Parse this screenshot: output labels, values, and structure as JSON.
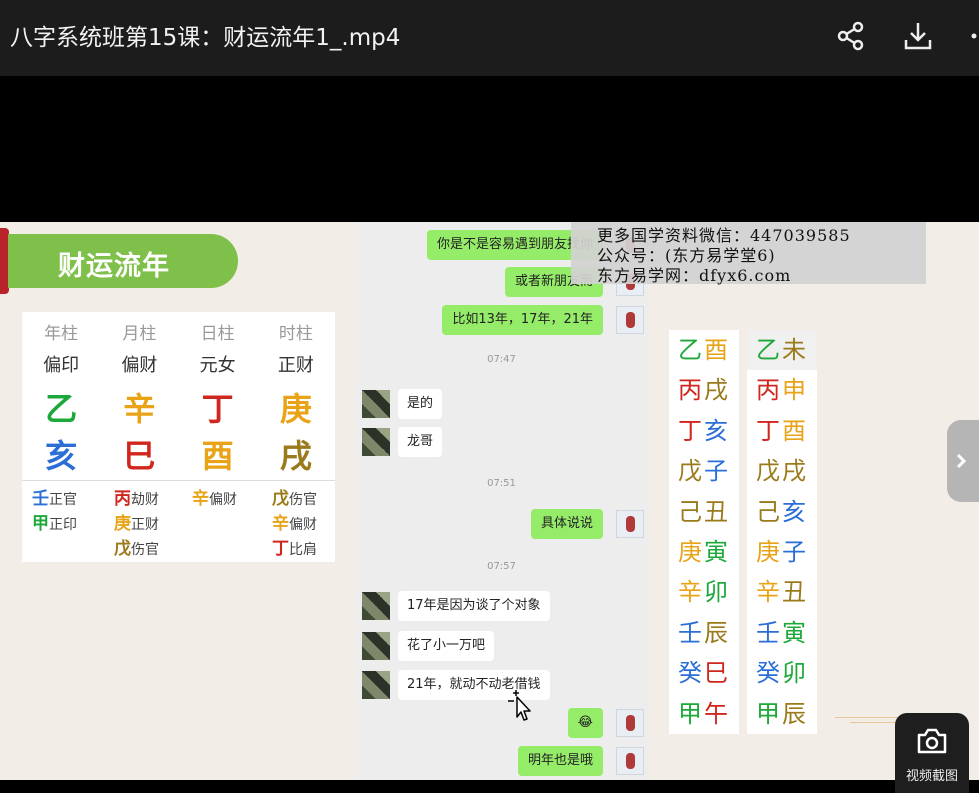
{
  "window": {
    "title": "八字系统班第15课：财运流年1_.mp4"
  },
  "toolbar": {
    "share_icon": "share-icon",
    "download_icon": "download-icon",
    "more_icon": "more-icon"
  },
  "slide": {
    "banner": "财运流年",
    "chart": {
      "headers": [
        "年柱",
        "月柱",
        "日柱",
        "时柱"
      ],
      "gods": [
        "偏印",
        "偏财",
        "元女",
        "正财"
      ],
      "stems": [
        {
          "char": "乙",
          "color": "#1fa83a"
        },
        {
          "char": "辛",
          "color": "#e8a317"
        },
        {
          "char": "丁",
          "color": "#d0261d"
        },
        {
          "char": "庚",
          "color": "#e8a317"
        }
      ],
      "branches": [
        {
          "char": "亥",
          "color": "#2b6fd6"
        },
        {
          "char": "巳",
          "color": "#d0261d"
        },
        {
          "char": "酉",
          "color": "#e8a317"
        },
        {
          "char": "戌",
          "color": "#9a7a1a"
        }
      ],
      "hidden": [
        [
          {
            "stem": "壬",
            "god": "正官",
            "color": "#2b6fd6"
          },
          {
            "stem": "甲",
            "god": "正印",
            "color": "#1fa83a"
          }
        ],
        [
          {
            "stem": "丙",
            "god": "劫财",
            "color": "#d0261d"
          },
          {
            "stem": "庚",
            "god": "正财",
            "color": "#e8a317"
          },
          {
            "stem": "戊",
            "god": "伤官",
            "color": "#9a7a1a"
          }
        ],
        [
          {
            "stem": "辛",
            "god": "偏财",
            "color": "#e8a317"
          }
        ],
        [
          {
            "stem": "戊",
            "god": "伤官",
            "color": "#9a7a1a"
          },
          {
            "stem": "辛",
            "god": "偏财",
            "color": "#e8a317"
          },
          {
            "stem": "丁",
            "god": "比肩",
            "color": "#d0261d"
          }
        ]
      ]
    }
  },
  "chat": {
    "messages": [
      {
        "side": "right",
        "text": "你是不是容易遇到朋友找你"
      },
      {
        "side": "right",
        "text": "或者新朋友而"
      },
      {
        "side": "right",
        "text": "比如13年，17年，21年"
      },
      {
        "time": "07:47"
      },
      {
        "side": "left",
        "text": "是的"
      },
      {
        "side": "left",
        "text": "龙哥"
      },
      {
        "time": "07:51"
      },
      {
        "side": "right",
        "text": "具体说说"
      },
      {
        "time": "07:57"
      },
      {
        "side": "left",
        "text": "17年是因为谈了个对象"
      },
      {
        "side": "left",
        "text": "花了小一万吧"
      },
      {
        "side": "left",
        "text": "21年，就动不动老借钱"
      },
      {
        "side": "right",
        "text": "😂"
      },
      {
        "side": "right",
        "text": "明年也是哦"
      }
    ]
  },
  "watermark": {
    "line1": "更多国学资料微信：447039585",
    "line2": "公众号：(东方易学堂6)",
    "line3": "东方易学网：dfyx6.com"
  },
  "years_table": {
    "left": [
      [
        {
          "c": "乙",
          "color": "#1fa83a"
        },
        {
          "c": "酉",
          "color": "#e8a317"
        }
      ],
      [
        {
          "c": "丙",
          "color": "#d0261d"
        },
        {
          "c": "戌",
          "color": "#9a7a1a"
        }
      ],
      [
        {
          "c": "丁",
          "color": "#d0261d"
        },
        {
          "c": "亥",
          "color": "#2b6fd6"
        }
      ],
      [
        {
          "c": "戊",
          "color": "#9a7a1a"
        },
        {
          "c": "子",
          "color": "#2b6fd6"
        }
      ],
      [
        {
          "c": "己",
          "color": "#9a7a1a"
        },
        {
          "c": "丑",
          "color": "#9a7a1a"
        }
      ],
      [
        {
          "c": "庚",
          "color": "#e8a317"
        },
        {
          "c": "寅",
          "color": "#1fa83a"
        }
      ],
      [
        {
          "c": "辛",
          "color": "#e8a317"
        },
        {
          "c": "卯",
          "color": "#1fa83a"
        }
      ],
      [
        {
          "c": "壬",
          "color": "#2b6fd6"
        },
        {
          "c": "辰",
          "color": "#9a7a1a"
        }
      ],
      [
        {
          "c": "癸",
          "color": "#2b6fd6"
        },
        {
          "c": "巳",
          "color": "#d0261d"
        }
      ],
      [
        {
          "c": "甲",
          "color": "#1fa83a"
        },
        {
          "c": "午",
          "color": "#d0261d"
        }
      ]
    ],
    "right": [
      [
        {
          "c": "乙",
          "color": "#1fa83a"
        },
        {
          "c": "未",
          "color": "#9a7a1a"
        }
      ],
      [
        {
          "c": "丙",
          "color": "#d0261d"
        },
        {
          "c": "申",
          "color": "#e8a317"
        }
      ],
      [
        {
          "c": "丁",
          "color": "#d0261d"
        },
        {
          "c": "酉",
          "color": "#e8a317"
        }
      ],
      [
        {
          "c": "戊",
          "color": "#9a7a1a"
        },
        {
          "c": "戌",
          "color": "#9a7a1a"
        }
      ],
      [
        {
          "c": "己",
          "color": "#9a7a1a"
        },
        {
          "c": "亥",
          "color": "#2b6fd6"
        }
      ],
      [
        {
          "c": "庚",
          "color": "#e8a317"
        },
        {
          "c": "子",
          "color": "#2b6fd6"
        }
      ],
      [
        {
          "c": "辛",
          "color": "#e8a317"
        },
        {
          "c": "丑",
          "color": "#9a7a1a"
        }
      ],
      [
        {
          "c": "壬",
          "color": "#2b6fd6"
        },
        {
          "c": "寅",
          "color": "#1fa83a"
        }
      ],
      [
        {
          "c": "癸",
          "color": "#2b6fd6"
        },
        {
          "c": "卯",
          "color": "#1fa83a"
        }
      ],
      [
        {
          "c": "甲",
          "color": "#1fa83a"
        },
        {
          "c": "辰",
          "color": "#9a7a1a"
        }
      ]
    ]
  },
  "controls": {
    "screenshot_label": "视频截图",
    "next_icon": "chevron-right-icon"
  }
}
